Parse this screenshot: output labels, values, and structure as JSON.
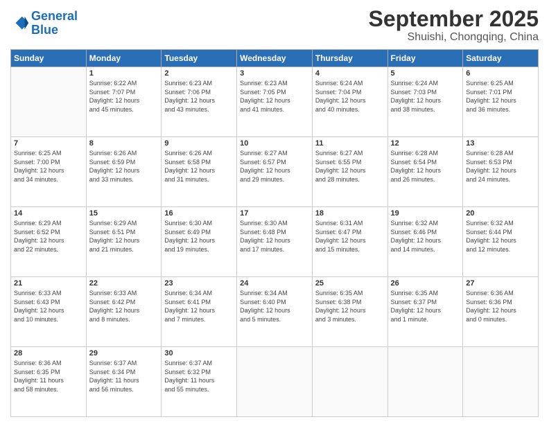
{
  "header": {
    "logo_line1": "General",
    "logo_line2": "Blue",
    "month": "September 2025",
    "location": "Shuishi, Chongqing, China"
  },
  "weekdays": [
    "Sunday",
    "Monday",
    "Tuesday",
    "Wednesday",
    "Thursday",
    "Friday",
    "Saturday"
  ],
  "weeks": [
    [
      {
        "day": "",
        "info": ""
      },
      {
        "day": "1",
        "info": "Sunrise: 6:22 AM\nSunset: 7:07 PM\nDaylight: 12 hours\nand 45 minutes."
      },
      {
        "day": "2",
        "info": "Sunrise: 6:23 AM\nSunset: 7:06 PM\nDaylight: 12 hours\nand 43 minutes."
      },
      {
        "day": "3",
        "info": "Sunrise: 6:23 AM\nSunset: 7:05 PM\nDaylight: 12 hours\nand 41 minutes."
      },
      {
        "day": "4",
        "info": "Sunrise: 6:24 AM\nSunset: 7:04 PM\nDaylight: 12 hours\nand 40 minutes."
      },
      {
        "day": "5",
        "info": "Sunrise: 6:24 AM\nSunset: 7:03 PM\nDaylight: 12 hours\nand 38 minutes."
      },
      {
        "day": "6",
        "info": "Sunrise: 6:25 AM\nSunset: 7:01 PM\nDaylight: 12 hours\nand 36 minutes."
      }
    ],
    [
      {
        "day": "7",
        "info": "Sunrise: 6:25 AM\nSunset: 7:00 PM\nDaylight: 12 hours\nand 34 minutes."
      },
      {
        "day": "8",
        "info": "Sunrise: 6:26 AM\nSunset: 6:59 PM\nDaylight: 12 hours\nand 33 minutes."
      },
      {
        "day": "9",
        "info": "Sunrise: 6:26 AM\nSunset: 6:58 PM\nDaylight: 12 hours\nand 31 minutes."
      },
      {
        "day": "10",
        "info": "Sunrise: 6:27 AM\nSunset: 6:57 PM\nDaylight: 12 hours\nand 29 minutes."
      },
      {
        "day": "11",
        "info": "Sunrise: 6:27 AM\nSunset: 6:55 PM\nDaylight: 12 hours\nand 28 minutes."
      },
      {
        "day": "12",
        "info": "Sunrise: 6:28 AM\nSunset: 6:54 PM\nDaylight: 12 hours\nand 26 minutes."
      },
      {
        "day": "13",
        "info": "Sunrise: 6:28 AM\nSunset: 6:53 PM\nDaylight: 12 hours\nand 24 minutes."
      }
    ],
    [
      {
        "day": "14",
        "info": "Sunrise: 6:29 AM\nSunset: 6:52 PM\nDaylight: 12 hours\nand 22 minutes."
      },
      {
        "day": "15",
        "info": "Sunrise: 6:29 AM\nSunset: 6:51 PM\nDaylight: 12 hours\nand 21 minutes."
      },
      {
        "day": "16",
        "info": "Sunrise: 6:30 AM\nSunset: 6:49 PM\nDaylight: 12 hours\nand 19 minutes."
      },
      {
        "day": "17",
        "info": "Sunrise: 6:30 AM\nSunset: 6:48 PM\nDaylight: 12 hours\nand 17 minutes."
      },
      {
        "day": "18",
        "info": "Sunrise: 6:31 AM\nSunset: 6:47 PM\nDaylight: 12 hours\nand 15 minutes."
      },
      {
        "day": "19",
        "info": "Sunrise: 6:32 AM\nSunset: 6:46 PM\nDaylight: 12 hours\nand 14 minutes."
      },
      {
        "day": "20",
        "info": "Sunrise: 6:32 AM\nSunset: 6:44 PM\nDaylight: 12 hours\nand 12 minutes."
      }
    ],
    [
      {
        "day": "21",
        "info": "Sunrise: 6:33 AM\nSunset: 6:43 PM\nDaylight: 12 hours\nand 10 minutes."
      },
      {
        "day": "22",
        "info": "Sunrise: 6:33 AM\nSunset: 6:42 PM\nDaylight: 12 hours\nand 8 minutes."
      },
      {
        "day": "23",
        "info": "Sunrise: 6:34 AM\nSunset: 6:41 PM\nDaylight: 12 hours\nand 7 minutes."
      },
      {
        "day": "24",
        "info": "Sunrise: 6:34 AM\nSunset: 6:40 PM\nDaylight: 12 hours\nand 5 minutes."
      },
      {
        "day": "25",
        "info": "Sunrise: 6:35 AM\nSunset: 6:38 PM\nDaylight: 12 hours\nand 3 minutes."
      },
      {
        "day": "26",
        "info": "Sunrise: 6:35 AM\nSunset: 6:37 PM\nDaylight: 12 hours\nand 1 minute."
      },
      {
        "day": "27",
        "info": "Sunrise: 6:36 AM\nSunset: 6:36 PM\nDaylight: 12 hours\nand 0 minutes."
      }
    ],
    [
      {
        "day": "28",
        "info": "Sunrise: 6:36 AM\nSunset: 6:35 PM\nDaylight: 11 hours\nand 58 minutes."
      },
      {
        "day": "29",
        "info": "Sunrise: 6:37 AM\nSunset: 6:34 PM\nDaylight: 11 hours\nand 56 minutes."
      },
      {
        "day": "30",
        "info": "Sunrise: 6:37 AM\nSunset: 6:32 PM\nDaylight: 11 hours\nand 55 minutes."
      },
      {
        "day": "",
        "info": ""
      },
      {
        "day": "",
        "info": ""
      },
      {
        "day": "",
        "info": ""
      },
      {
        "day": "",
        "info": ""
      }
    ]
  ]
}
